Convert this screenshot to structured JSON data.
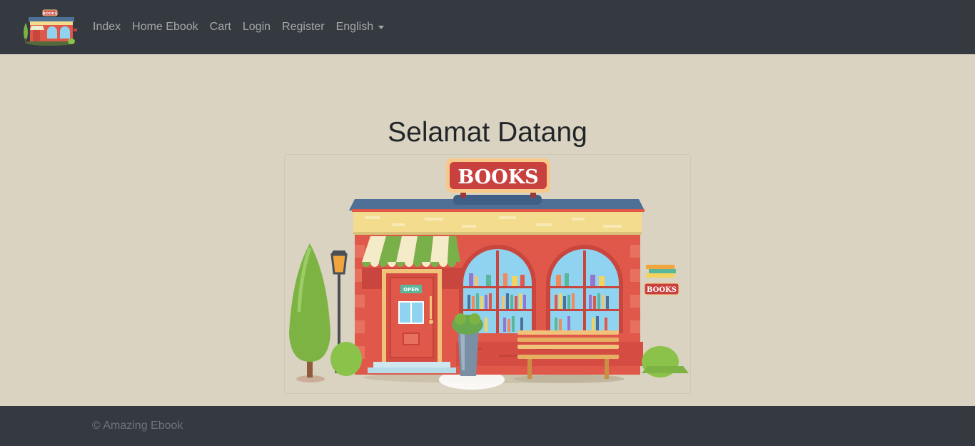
{
  "navbar": {
    "logo_icon": "bookstore-logo-icon",
    "items": [
      {
        "label": "Index"
      },
      {
        "label": "Home Ebook"
      },
      {
        "label": "Cart"
      },
      {
        "label": "Login"
      },
      {
        "label": "Register"
      }
    ],
    "language": {
      "selected": "English",
      "icon": "chevron-down-icon"
    }
  },
  "main": {
    "title": "Selamat Datang",
    "illustration": {
      "icon": "bookstore-illustration",
      "sign_text": "BOOKS",
      "small_sign_text": "BOOKS",
      "door_sign_text": "OPEN"
    }
  },
  "footer": {
    "copyright": "© Amazing Ebook"
  },
  "colors": {
    "navbar_bg": "#343a40",
    "page_bg": "#dad3c1",
    "footer_bg": "#343a40",
    "nav_text": "#9a9da0",
    "title_text": "#212529",
    "shop_red": "#e05a4e",
    "sign_red": "#c8413f"
  }
}
